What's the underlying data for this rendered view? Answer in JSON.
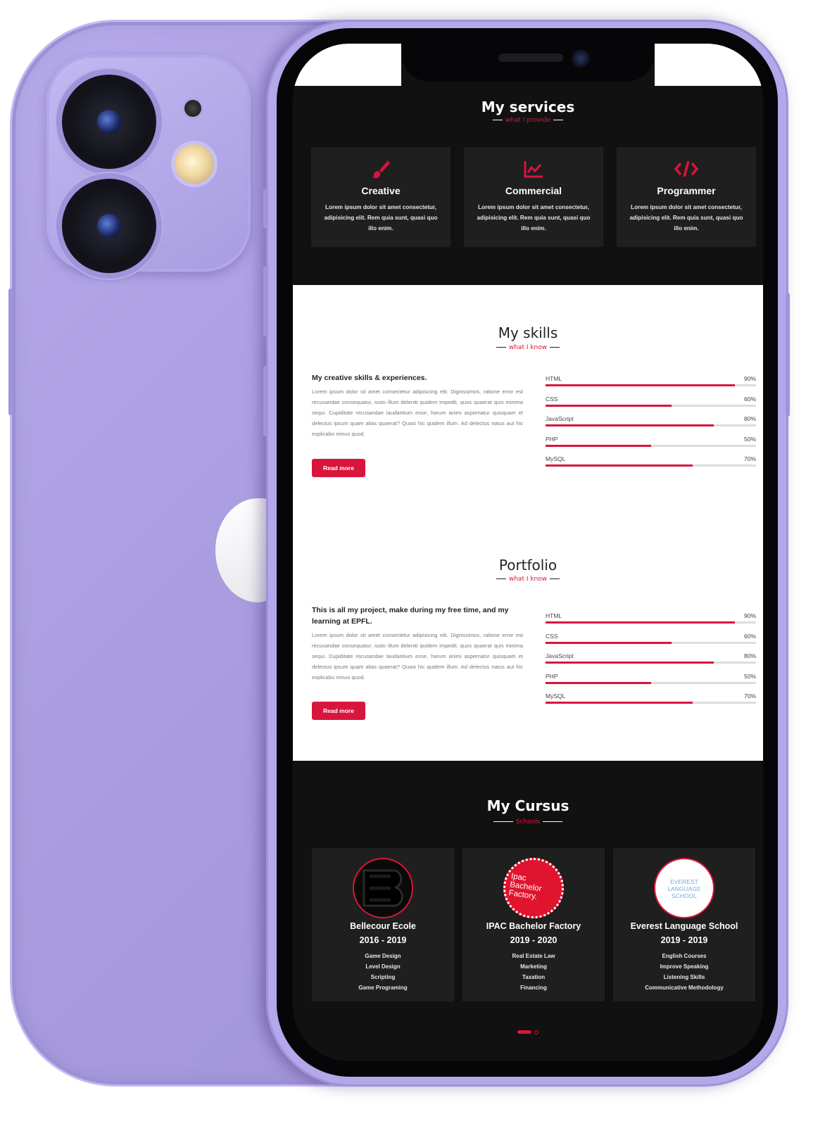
{
  "services": {
    "title": "My services",
    "subtitle": "what I provide",
    "cards": [
      {
        "icon": "paintbrush-icon",
        "title": "Creative",
        "desc": "Lorem ipsum dolor sit amet consectetur, adipisicing elit. Rem quia sunt, quasi quo illo enim."
      },
      {
        "icon": "chart-line-icon",
        "title": "Commercial",
        "desc": "Lorem ipsum dolor sit amet consectetur, adipisicing elit. Rem quia sunt, quasi quo illo enim."
      },
      {
        "icon": "code-icon",
        "title": "Programmer",
        "desc": "Lorem ipsum dolor sit amet consectetur, adipisicing elit. Rem quia sunt, quasi quo illo enim."
      }
    ]
  },
  "skills": {
    "title": "My skills",
    "subtitle": "what I know",
    "heading": "My creative skills & experiences.",
    "text": "Lorem ipsum dolor sit amet consectetur adipisicing elit. Dignissimos, ratione error est recusandae consequatur, iusto illum deleniti quidem impedit, quos quaerat quis minima sequi. Cupiditate recusandae laudantium esse, harum animi aspernatur quisquam et delectus ipsum quam alias quaerat? Quasi hic quidem illum. Ad delectus natus aut hic explicabo minus quod.",
    "button": "Read more",
    "bars": [
      {
        "label": "HTML",
        "pct_text": "90%",
        "value": 0.9
      },
      {
        "label": "CSS",
        "pct_text": "60%",
        "value": 0.6
      },
      {
        "label": "JavaScript",
        "pct_text": "80%",
        "value": 0.8
      },
      {
        "label": "PHP",
        "pct_text": "50%",
        "value": 0.5
      },
      {
        "label": "MySQL",
        "pct_text": "70%",
        "value": 0.7
      }
    ]
  },
  "portfolio": {
    "title": "Portfolio",
    "subtitle": "what I know",
    "heading": "This is all my project, make during my free time, and my learning at EPFL.",
    "text": "Lorem ipsum dolor sit amet consectetur adipisicing elit. Dignissimos, ratione error est recusandae consequatur, iusto illum deleniti quidem impedit, quos quaerat quis minima sequi. Cupiditate recusandae laudantium esse, harum animi aspernatur quisquam et delectus ipsum quam alias quaerat? Quasi hic quidem illum. Ad delectus natus aut hic explicabo minus quod.",
    "button": "Read more",
    "bars": [
      {
        "label": "HTML",
        "pct_text": "90%",
        "value": 0.9
      },
      {
        "label": "CSS",
        "pct_text": "60%",
        "value": 0.6
      },
      {
        "label": "JavaScript",
        "pct_text": "80%",
        "value": 0.8
      },
      {
        "label": "PHP",
        "pct_text": "50%",
        "value": 0.5
      },
      {
        "label": "MySQL",
        "pct_text": "70%",
        "value": 0.7
      }
    ]
  },
  "cursus": {
    "title": "My Cursus",
    "subtitle": "Schools",
    "schools": [
      {
        "name": "Bellecour Ecole",
        "years": "2016 - 2019",
        "logo_text": "",
        "items": [
          "Game Design",
          "Level Design",
          "Scripting",
          "Game Programing"
        ]
      },
      {
        "name": "IPAC Bachelor Factory",
        "years": "2019 - 2020",
        "logo_text": "Ipac Bachelor Factory.",
        "items": [
          "Real Estate Law",
          "Marketing",
          "Taxation",
          "Financing"
        ]
      },
      {
        "name": "Everest Language School",
        "years": "2019 - 2019",
        "logo_text": "EVEREST LANGUAGE SCHOOL",
        "items": [
          "English Courses",
          "Improve Speaking",
          "Listening Skills",
          "Communicative Methodology"
        ]
      }
    ]
  },
  "colors": {
    "accent": "#d8153c",
    "dark_bg": "#111111",
    "card_bg": "#1f1f1f",
    "phone": "#a99cdf"
  }
}
